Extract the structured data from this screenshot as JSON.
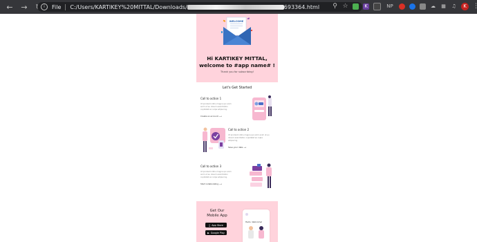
{
  "browser": {
    "protocol_label": "File",
    "url_prefix": "C:/Users/KARTIKEY%20MITTAL/Downloads/",
    "url_suffix": "693364.html",
    "ext_np": "NP",
    "profile_initial": "K"
  },
  "email": {
    "envelope_label": "WELCOME",
    "greeting_line1": "Hi KARTIKEY MITTAL,",
    "greeting_line2": "welcome to #app name# !",
    "thanks": "Thank you for subscribing!",
    "section_title": "Let's Get Started",
    "ctas": [
      {
        "title": "Call to action 1",
        "body": "Ut proident nibhu magna qui enim anim ut eu dosum exercitation cupidatat ex culpa adipiscing.",
        "link": "Create an account ⟶"
      },
      {
        "title": "Call to action 2",
        "body": "Ut proident nibhu magna qui enim anim ut eu dosum exercitation cupidatat ex culpa adipiscing.",
        "link": "Save your data ⟶"
      },
      {
        "title": "Call to action 3",
        "body": "Ut proident nibhu magna qui enim anim ut eu dosum exercitation cupidatat ex culpa adipiscing.",
        "link": "Start collaborating ⟶"
      }
    ],
    "mobile": {
      "title_line1": "Get Our",
      "title_line2": "Mobile App",
      "app_store": "App Store",
      "google_play": "Google Play",
      "phone_label": "Hello, Welcome!"
    }
  },
  "colors": {
    "hero_bg": "#ffd3dc",
    "chrome_bg": "#35363a",
    "accent_purple": "#7b3fa0",
    "envelope_blue": "#2f66b3"
  }
}
